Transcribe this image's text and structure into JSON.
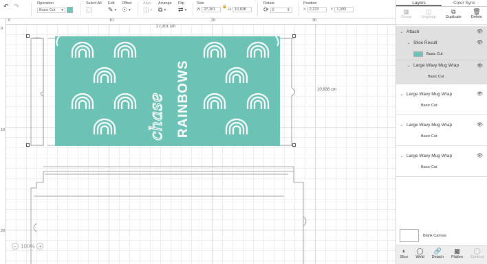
{
  "colors": {
    "teal": "#6cc3b5",
    "text": "#333333",
    "panel_bg": "#ffffff",
    "attach_bg": "#e0e0e0"
  },
  "toolbar": {
    "undo_icon": "undo-icon",
    "redo_icon": "redo-icon",
    "operation": {
      "label": "Operation",
      "value": "Basic Cut"
    },
    "select_all": {
      "label": "Select All"
    },
    "edit": {
      "label": "Edit"
    },
    "offset": {
      "label": "Offset"
    },
    "align": {
      "label": "Align"
    },
    "arrange": {
      "label": "Arrange"
    },
    "flip": {
      "label": "Flip"
    },
    "size": {
      "label": "Size",
      "w_label": "W",
      "w_value": "27,301",
      "h_label": "H",
      "h_value": "10,838"
    },
    "rotate": {
      "label": "Rotate",
      "value": "0"
    },
    "position": {
      "label": "Position",
      "x_label": "X",
      "x_value": "2,223",
      "y_label": "Y",
      "y_value": "1,093"
    }
  },
  "rulers": {
    "top": [
      "0",
      "10",
      "20",
      "30"
    ],
    "left": [
      "0",
      "10",
      "20"
    ]
  },
  "canvas": {
    "width_label": "27,301 cm",
    "height_label": "10,838 cm",
    "design_text": {
      "script": "chase",
      "block": "RAINBOWS"
    },
    "zoom": "100%"
  },
  "panel": {
    "tabs": [
      "Layers",
      "Color Sync"
    ],
    "actions": [
      "Group",
      "Ungroup",
      "Duplicate",
      "Delete"
    ],
    "attach": {
      "label": "Attach",
      "slice_result": {
        "label": "Slice Result",
        "sub": "Basic Cut"
      },
      "wrap": {
        "label": "Large Wavy Mug Wrap",
        "sub": "Basic Cut"
      }
    },
    "groups": [
      {
        "label": "Large Wavy Mug Wrap",
        "sub": "Basic Cut"
      },
      {
        "label": "Large Wavy Mug Wrap",
        "sub": "Basic Cut"
      },
      {
        "label": "Large Wavy Mug Wrap",
        "sub": "Basic Cut"
      }
    ],
    "blank_canvas": "Blank Canvas",
    "bottom_actions": [
      "Slice",
      "Weld",
      "Detach",
      "Flatten",
      "Contour"
    ]
  }
}
